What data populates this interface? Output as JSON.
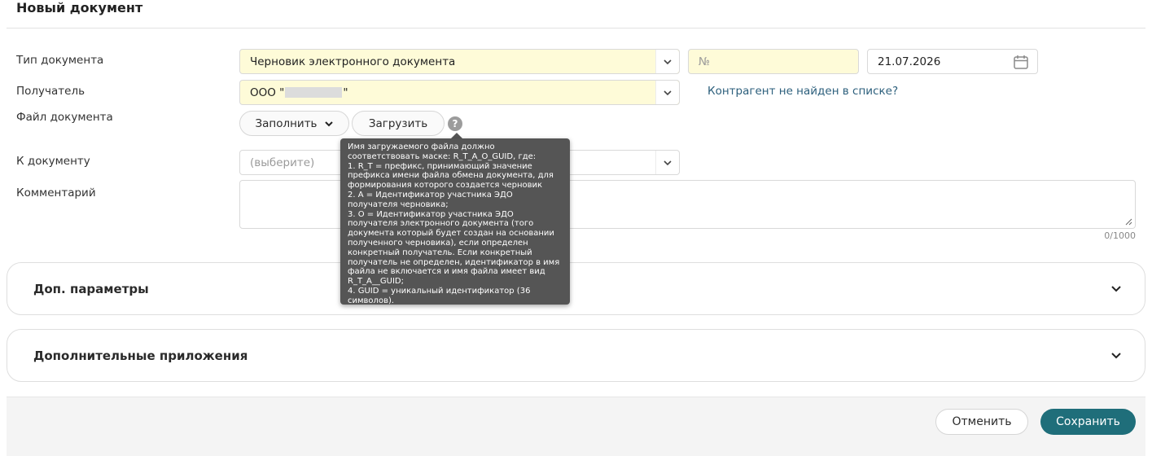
{
  "page": {
    "title": "Новый документ"
  },
  "form": {
    "doc_type": {
      "label": "Тип документа",
      "value": "Черновик электронного документа"
    },
    "number": {
      "placeholder": "№"
    },
    "date": {
      "value": "21.07.2026"
    },
    "recipient": {
      "label": "Получатель",
      "value_prefix": "ООО \"",
      "value_suffix": "\"",
      "not_found_link": "Контрагент не найден в списке?"
    },
    "file": {
      "label": "Файл документа",
      "fill_button": "Заполнить",
      "upload_button": "Загрузить",
      "help_symbol": "?"
    },
    "to_document": {
      "label": "К документу",
      "placeholder": "(выберите)"
    },
    "comment": {
      "label": "Комментарий",
      "counter": "0/1000"
    }
  },
  "tooltip": {
    "text": "Имя загружаемого файла должно соответствовать маске: R_T_A_O_GUID, где:\n1. R_T = префикс, принимающий значение префикса имени файла обмена документа, для формирования которого создается черновик\n2. A = Идентификатор участника ЭДО получателя черновика;\n3. O = Идентификатор участника ЭДО получателя электронного документа (того документа который будет создан на основании полученного черновика), если определен конкретный получатель. Если конкретный получатель не определен, идентификатор в имя файла не включается и имя файла имеет вид R_T_A__GUID;\n4. GUID = уникальный идентификатор (36 символов)."
  },
  "sections": {
    "extra_params": "Доп. параметры",
    "attachments": "Дополнительные приложения"
  },
  "footer": {
    "cancel": "Отменить",
    "save": "Сохранить"
  },
  "colors": {
    "accent": "#1f6e7a",
    "link": "#2c5f7c",
    "highlight_field": "#fefbd8",
    "tooltip_bg": "#555555"
  },
  "icons": {
    "dropdown": "chevron-down-icon",
    "date": "calendar-icon",
    "help": "question-icon",
    "accordion": "chevron-down-icon"
  }
}
